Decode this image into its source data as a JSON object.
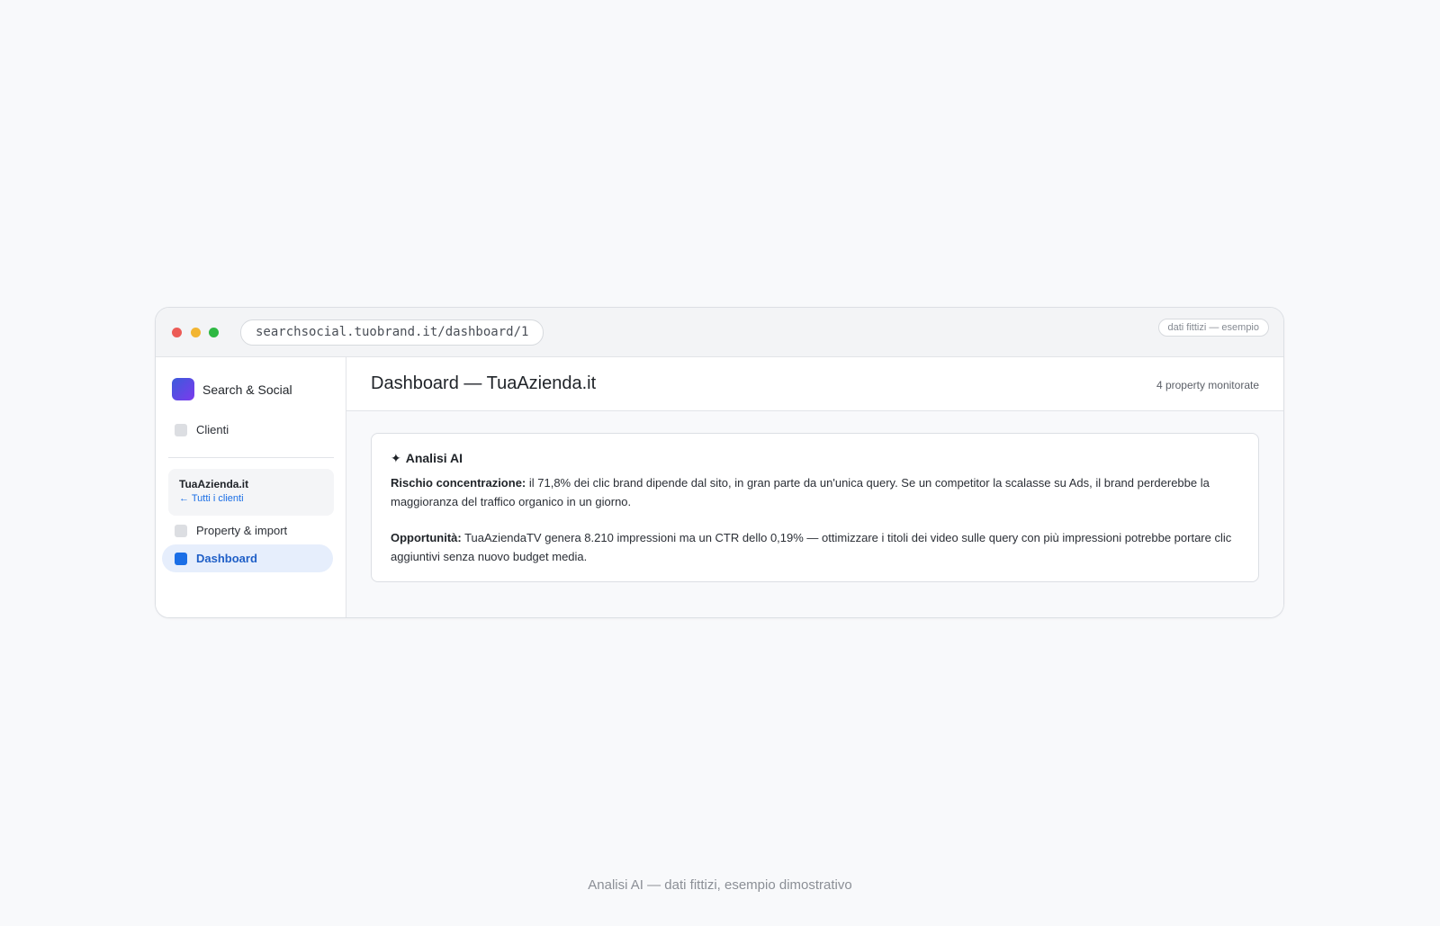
{
  "window": {
    "url": "searchsocial.tuobrand.it/dashboard/1",
    "tag": "dati fittizi — esempio"
  },
  "sidebar": {
    "brand": "Search & Social",
    "clients_label": "Clienti",
    "current_client": {
      "name": "TuaAzienda.it",
      "back_link": "← Tutti i clienti"
    },
    "items": [
      {
        "label": "Property & import"
      },
      {
        "label": "Dashboard",
        "active": true
      }
    ]
  },
  "header": {
    "title": "Dashboard — TuaAzienda.it",
    "meta": "4 property monitorate"
  },
  "ai_card": {
    "icon": "sparkle-icon",
    "icon_glyph": "✦",
    "title": "Analisi AI",
    "blocks": [
      {
        "label": "Rischio concentrazione:",
        "text": " il 71,8% dei clic brand dipende dal sito, in gran parte da un'unica query. Se un competitor la scalasse su Ads, il brand perderebbe la maggioranza del traffico organico in un giorno."
      },
      {
        "label": "Opportunità:",
        "text": " TuaAziendaTV genera 8.210 impressioni ma un CTR dello 0,19% — ottimizzare i titoli dei video sulle query con più impressioni potrebbe portare clic aggiuntivi senza nuovo budget media."
      }
    ]
  },
  "caption": "Analisi AI — dati fittizi, esempio dimostrativo",
  "colors": {
    "accent": "#1a6ee6",
    "active_bg": "#e6eefc",
    "traffic_red": "#ec5b56",
    "traffic_yellow": "#f2b532",
    "traffic_green": "#2eb843"
  }
}
